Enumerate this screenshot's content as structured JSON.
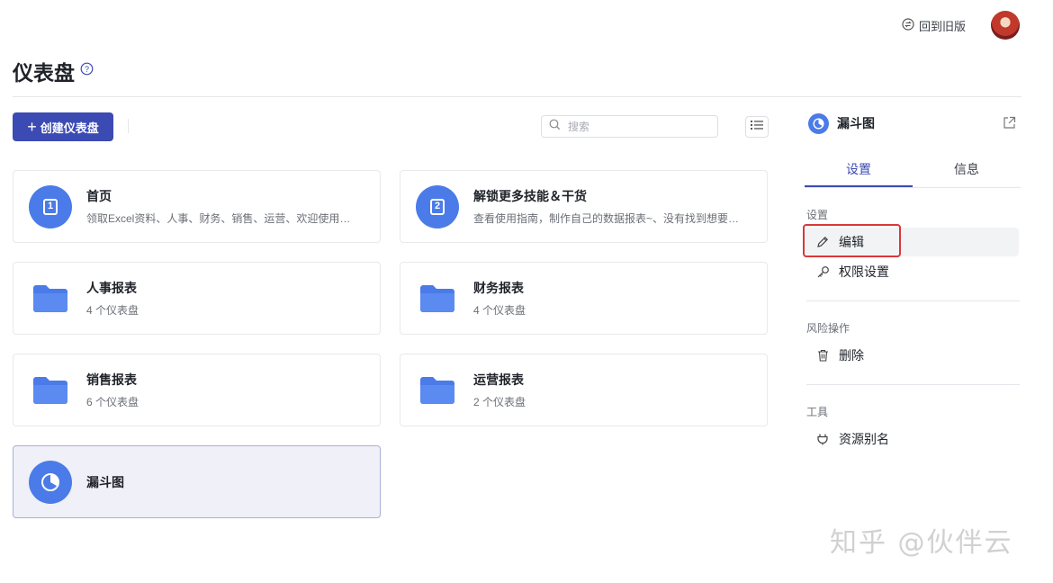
{
  "header": {
    "back_old_label": "回到旧版",
    "page_title": "仪表盘"
  },
  "toolbar": {
    "create_label": "创建仪表盘",
    "search_placeholder": "搜索"
  },
  "cards": [
    {
      "title": "首页",
      "subtitle": "领取Excel资料、人事、财务、销售、运营、欢迎使用伙...",
      "badge": "1",
      "icon": "number-one-icon"
    },
    {
      "title": "解锁更多技能＆干货",
      "subtitle": "查看使用指南，制作自己的数据报表~、没有找到想要的...",
      "badge": "2",
      "icon": "number-two-icon"
    },
    {
      "title": "人事报表",
      "subtitle": "4 个仪表盘",
      "icon": "folder-icon"
    },
    {
      "title": "财务报表",
      "subtitle": "4 个仪表盘",
      "icon": "folder-icon"
    },
    {
      "title": "销售报表",
      "subtitle": "6 个仪表盘",
      "icon": "folder-icon"
    },
    {
      "title": "运营报表",
      "subtitle": "2 个仪表盘",
      "icon": "folder-icon"
    },
    {
      "title": "漏斗图",
      "subtitle": "",
      "icon": "pie-chart-icon",
      "selected": true
    }
  ],
  "panel": {
    "title": "漏斗图",
    "tabs": [
      "设置",
      "信息"
    ],
    "active_tab": "设置",
    "sections": [
      {
        "title": "设置",
        "items": [
          "编辑",
          "权限设置"
        ]
      },
      {
        "title": "风险操作",
        "items": [
          "删除"
        ]
      },
      {
        "title": "工具",
        "items": [
          "资源别名"
        ]
      }
    ]
  },
  "watermark": "知乎 @伙伴云",
  "colors": {
    "primary": "#3b4bb3",
    "icon_blue": "#4a7be8",
    "highlight_red": "#d9383a"
  }
}
